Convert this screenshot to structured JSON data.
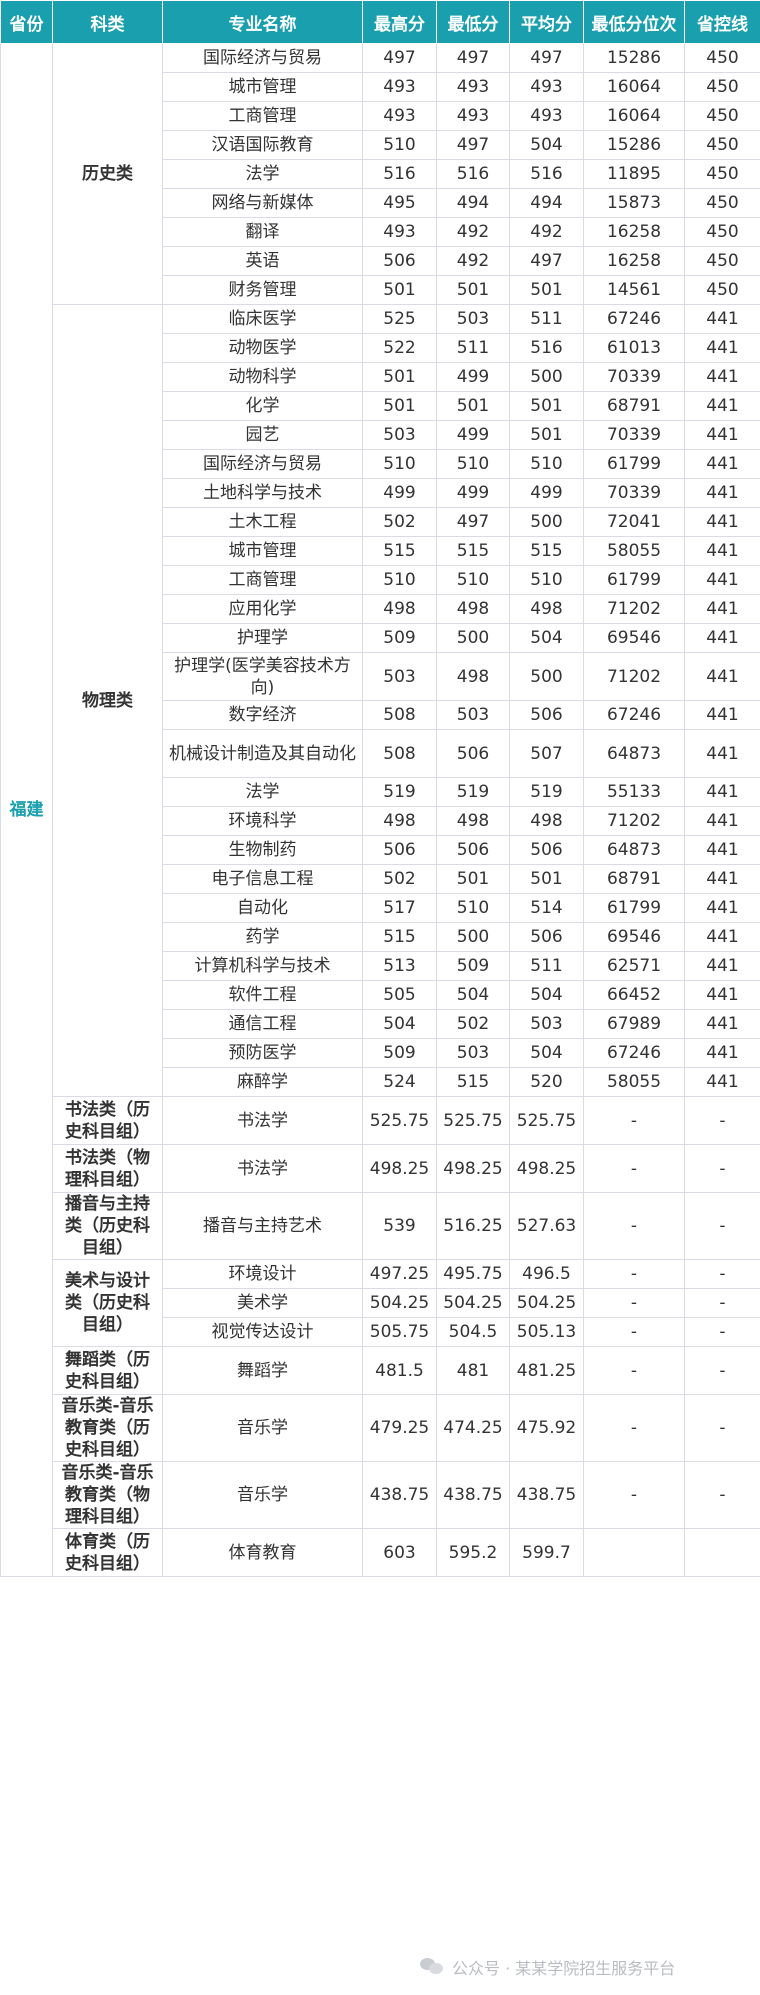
{
  "headers": [
    "省份",
    "科类",
    "专业名称",
    "最高分",
    "最低分",
    "平均分",
    "最低分位次",
    "省控线"
  ],
  "province": "福建",
  "groups": [
    {
      "category": "历史类",
      "rows": [
        [
          "国际经济与贸易",
          "497",
          "497",
          "497",
          "15286",
          "450"
        ],
        [
          "城市管理",
          "493",
          "493",
          "493",
          "16064",
          "450"
        ],
        [
          "工商管理",
          "493",
          "493",
          "493",
          "16064",
          "450"
        ],
        [
          "汉语国际教育",
          "510",
          "497",
          "504",
          "15286",
          "450"
        ],
        [
          "法学",
          "516",
          "516",
          "516",
          "11895",
          "450"
        ],
        [
          "网络与新媒体",
          "495",
          "494",
          "494",
          "15873",
          "450"
        ],
        [
          "翻译",
          "493",
          "492",
          "492",
          "16258",
          "450"
        ],
        [
          "英语",
          "506",
          "492",
          "497",
          "16258",
          "450"
        ],
        [
          "财务管理",
          "501",
          "501",
          "501",
          "14561",
          "450"
        ]
      ]
    },
    {
      "category": "物理类",
      "rows": [
        [
          "临床医学",
          "525",
          "503",
          "511",
          "67246",
          "441"
        ],
        [
          "动物医学",
          "522",
          "511",
          "516",
          "61013",
          "441"
        ],
        [
          "动物科学",
          "501",
          "499",
          "500",
          "70339",
          "441"
        ],
        [
          "化学",
          "501",
          "501",
          "501",
          "68791",
          "441"
        ],
        [
          "园艺",
          "503",
          "499",
          "501",
          "70339",
          "441"
        ],
        [
          "国际经济与贸易",
          "510",
          "510",
          "510",
          "61799",
          "441"
        ],
        [
          "土地科学与技术",
          "499",
          "499",
          "499",
          "70339",
          "441"
        ],
        [
          "土木工程",
          "502",
          "497",
          "500",
          "72041",
          "441"
        ],
        [
          "城市管理",
          "515",
          "515",
          "515",
          "58055",
          "441"
        ],
        [
          "工商管理",
          "510",
          "510",
          "510",
          "61799",
          "441"
        ],
        [
          "应用化学",
          "498",
          "498",
          "498",
          "71202",
          "441"
        ],
        [
          "护理学",
          "509",
          "500",
          "504",
          "69546",
          "441"
        ],
        [
          "护理学(医学美容技术方向)",
          "503",
          "498",
          "500",
          "71202",
          "441"
        ],
        [
          "数字经济",
          "508",
          "503",
          "506",
          "67246",
          "441"
        ],
        [
          "机械设计制造及其自动化",
          "508",
          "506",
          "507",
          "64873",
          "441"
        ],
        [
          "法学",
          "519",
          "519",
          "519",
          "55133",
          "441"
        ],
        [
          "环境科学",
          "498",
          "498",
          "498",
          "71202",
          "441"
        ],
        [
          "生物制药",
          "506",
          "506",
          "506",
          "64873",
          "441"
        ],
        [
          "电子信息工程",
          "502",
          "501",
          "501",
          "68791",
          "441"
        ],
        [
          "自动化",
          "517",
          "510",
          "514",
          "61799",
          "441"
        ],
        [
          "药学",
          "515",
          "500",
          "506",
          "69546",
          "441"
        ],
        [
          "计算机科学与技术",
          "513",
          "509",
          "511",
          "62571",
          "441"
        ],
        [
          "软件工程",
          "505",
          "504",
          "504",
          "66452",
          "441"
        ],
        [
          "通信工程",
          "504",
          "502",
          "503",
          "67989",
          "441"
        ],
        [
          "预防医学",
          "509",
          "503",
          "504",
          "67246",
          "441"
        ],
        [
          "麻醉学",
          "524",
          "515",
          "520",
          "58055",
          "441"
        ]
      ]
    },
    {
      "category": "书法类（历史科目组）",
      "rows": [
        [
          "书法学",
          "525.75",
          "525.75",
          "525.75",
          "-",
          "-"
        ]
      ]
    },
    {
      "category": "书法类（物理科目组）",
      "rows": [
        [
          "书法学",
          "498.25",
          "498.25",
          "498.25",
          "-",
          "-"
        ]
      ]
    },
    {
      "category": "播音与主持类（历史科目组）",
      "rows": [
        [
          "播音与主持艺术",
          "539",
          "516.25",
          "527.63",
          "-",
          "-"
        ]
      ]
    },
    {
      "category": "美术与设计类（历史科目组）",
      "rows": [
        [
          "环境设计",
          "497.25",
          "495.75",
          "496.5",
          "-",
          "-"
        ],
        [
          "美术学",
          "504.25",
          "504.25",
          "504.25",
          "-",
          "-"
        ],
        [
          "视觉传达设计",
          "505.75",
          "504.5",
          "505.13",
          "-",
          "-"
        ]
      ]
    },
    {
      "category": "舞蹈类（历史科目组）",
      "rows": [
        [
          "舞蹈学",
          "481.5",
          "481",
          "481.25",
          "-",
          "-"
        ]
      ]
    },
    {
      "category": "音乐类-音乐教育类（历史科目组）",
      "rows": [
        [
          "音乐学",
          "479.25",
          "474.25",
          "475.92",
          "-",
          "-"
        ]
      ]
    },
    {
      "category": "音乐类-音乐教育类（物理科目组）",
      "rows": [
        [
          "音乐学",
          "438.75",
          "438.75",
          "438.75",
          "-",
          "-"
        ]
      ]
    },
    {
      "category": "体育类（历史科目组）",
      "rows": [
        [
          "体育教育",
          "603",
          "595.2",
          "599.7",
          "",
          ""
        ]
      ]
    }
  ],
  "watermark": {
    "icon": "wechat-icon",
    "text": "公众号 · 某某学院招生服务平台"
  }
}
